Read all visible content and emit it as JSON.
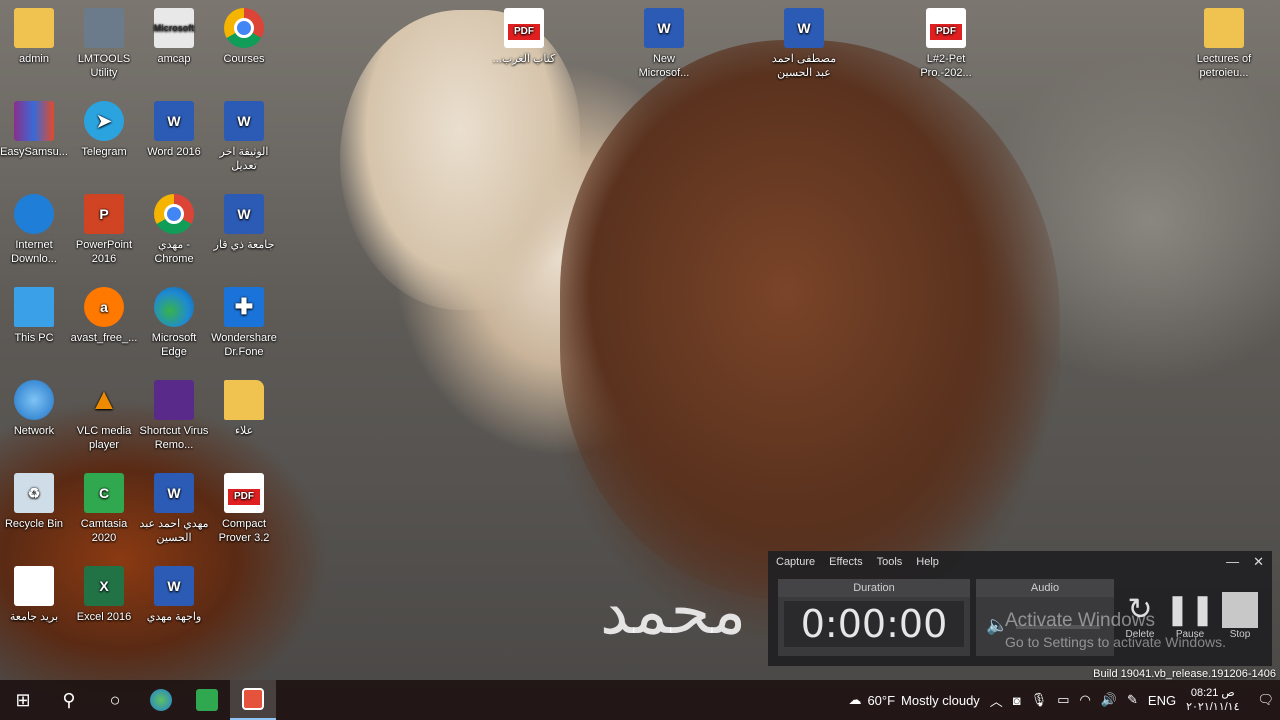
{
  "desktop": {
    "icons": [
      {
        "label": "admin",
        "icon": "folder-user-icon"
      },
      {
        "label": "LMTOOLS Utility",
        "icon": "lmtools-icon"
      },
      {
        "label": "amcap",
        "icon": "amcap-icon",
        "glyph": "Microsoft"
      },
      {
        "label": "Courses",
        "icon": "chrome-icon"
      },
      {
        "label": "...كتاب الغرب",
        "icon": "pdf-icon"
      },
      {
        "label": "New Microsof...",
        "icon": "word-icon",
        "glyph": "W"
      },
      {
        "label": "مصطفى احمد عبد الحسين",
        "icon": "word-icon",
        "glyph": "W"
      },
      {
        "label": "L#2-Pet Pro.-202...",
        "icon": "pdf-icon"
      },
      {
        "label": "Lectures of petroieu...",
        "icon": "folder-icon"
      },
      {
        "label": "EasySamsu...",
        "icon": "winrar-icon"
      },
      {
        "label": "Telegram",
        "icon": "telegram-icon",
        "glyph": "➤"
      },
      {
        "label": "Word 2016",
        "icon": "word-icon",
        "glyph": "W"
      },
      {
        "label": "الوثيقة اخر تعديل",
        "icon": "word-icon",
        "glyph": "W"
      },
      {
        "label": "Internet Downlo...",
        "icon": "internet-download-icon"
      },
      {
        "label": "PowerPoint 2016",
        "icon": "powerpoint-icon",
        "glyph": "P"
      },
      {
        "label": "مهدي - Chrome",
        "icon": "chrome-icon"
      },
      {
        "label": "جامعة ذي قار",
        "icon": "word-icon",
        "glyph": "W"
      },
      {
        "label": "This PC",
        "icon": "this-pc-icon"
      },
      {
        "label": "avast_free_...",
        "icon": "avast-icon",
        "glyph": "a"
      },
      {
        "label": "Microsoft Edge",
        "icon": "edge-icon"
      },
      {
        "label": "Wondershare Dr.Fone",
        "icon": "drfone-icon",
        "glyph": "✚"
      },
      {
        "label": "Network",
        "icon": "network-icon"
      },
      {
        "label": "VLC media player",
        "icon": "vlc-icon",
        "glyph": "▲"
      },
      {
        "label": "Shortcut Virus Remo...",
        "icon": "shortcut-virus-icon"
      },
      {
        "label": "علاء",
        "icon": "folder-pdf-icon"
      },
      {
        "label": "Recycle Bin",
        "icon": "recycle-bin-icon",
        "glyph": "♻"
      },
      {
        "label": "Camtasia 2020",
        "icon": "camtasia-icon",
        "glyph": "C"
      },
      {
        "label": "مهدي احمد عبد الحسين",
        "icon": "word-icon",
        "glyph": "W"
      },
      {
        "label": "Compact Prover 3.2",
        "icon": "pdf-icon"
      },
      {
        "label": "بريد جامعة",
        "icon": "document-icon"
      },
      {
        "label": "Excel 2016",
        "icon": "excel-icon",
        "glyph": "X"
      },
      {
        "label": "واجهة مهدي",
        "icon": "word-icon",
        "glyph": "W"
      }
    ]
  },
  "recorder": {
    "menu": [
      "Capture",
      "Effects",
      "Tools",
      "Help"
    ],
    "minimize_glyph": "—",
    "close_glyph": "✕",
    "duration_title": "Duration",
    "duration_value": "0:00:00",
    "audio_title": "Audio",
    "actions": [
      {
        "label": "Delete",
        "icon": "delete-restart-icon",
        "glyph": "↻"
      },
      {
        "label": "Pause",
        "icon": "pause-icon",
        "glyph": "❚❚"
      },
      {
        "label": "Stop",
        "icon": "stop-icon",
        "glyph": ""
      }
    ]
  },
  "watermark": {
    "line1": "Activate Windows",
    "line2": "Go to Settings to activate Windows."
  },
  "build_text": "Build 19041.vb_release.191206-1406",
  "taskbar": {
    "start_glyph": "⊞",
    "search_glyph": "⚲",
    "cortana_glyph": "○",
    "weather_temp": "60°F",
    "weather_text": "Mostly cloudy",
    "language": "ENG",
    "time": "08:21 ص",
    "date": "٢٠٢١/١١/١٤"
  },
  "calligraphy": "محمد"
}
